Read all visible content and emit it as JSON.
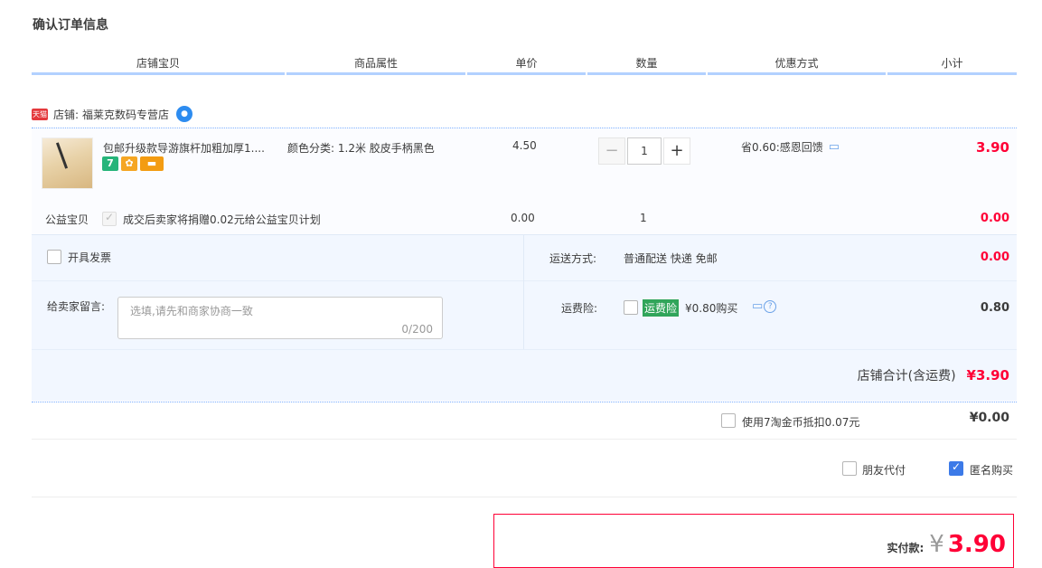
{
  "page_title": "确认订单信息",
  "columns": [
    "店铺宝贝",
    "商品属性",
    "单价",
    "数量",
    "优惠方式",
    "小计"
  ],
  "shop": {
    "tmall_badge": "天猫",
    "label": "店铺:",
    "name": "福莱克数码专营店"
  },
  "item": {
    "title": "包邮升级款导游旗杆加粗加厚1....",
    "attr_label": "颜色分类:",
    "attr_value": "1.2米 胶皮手柄黑色",
    "unit_price": "4.50",
    "quantity": "1",
    "discount": "省0.60:感恩回馈",
    "subtotal": "3.90",
    "badge_green": "7"
  },
  "charity": {
    "label": "公益宝贝",
    "text": "成交后卖家将捐赠0.02元给公益宝贝计划",
    "price": "0.00",
    "quantity": "1",
    "subtotal": "0.00"
  },
  "invoice": {
    "label": "开具发票"
  },
  "shipping": {
    "label": "运送方式:",
    "value": "普通配送 快递 免邮",
    "amount": "0.00"
  },
  "message": {
    "label": "给卖家留言:",
    "placeholder": "选填,请先和商家协商一致",
    "counter": "0/200"
  },
  "insurance": {
    "label": "运费险:",
    "tag": "运费险",
    "text": "¥0.80购买",
    "amount": "0.80"
  },
  "shop_total": {
    "label": "店铺合计(含运费)",
    "amount": "¥3.90"
  },
  "coin": {
    "text": "使用7淘金币抵扣0.07元",
    "amount": "¥0.00"
  },
  "options": {
    "friend_pay": "朋友代付",
    "anonymous": "匿名购买"
  },
  "payment": {
    "label": "实付款:",
    "currency": "¥",
    "amount": "3.90"
  }
}
